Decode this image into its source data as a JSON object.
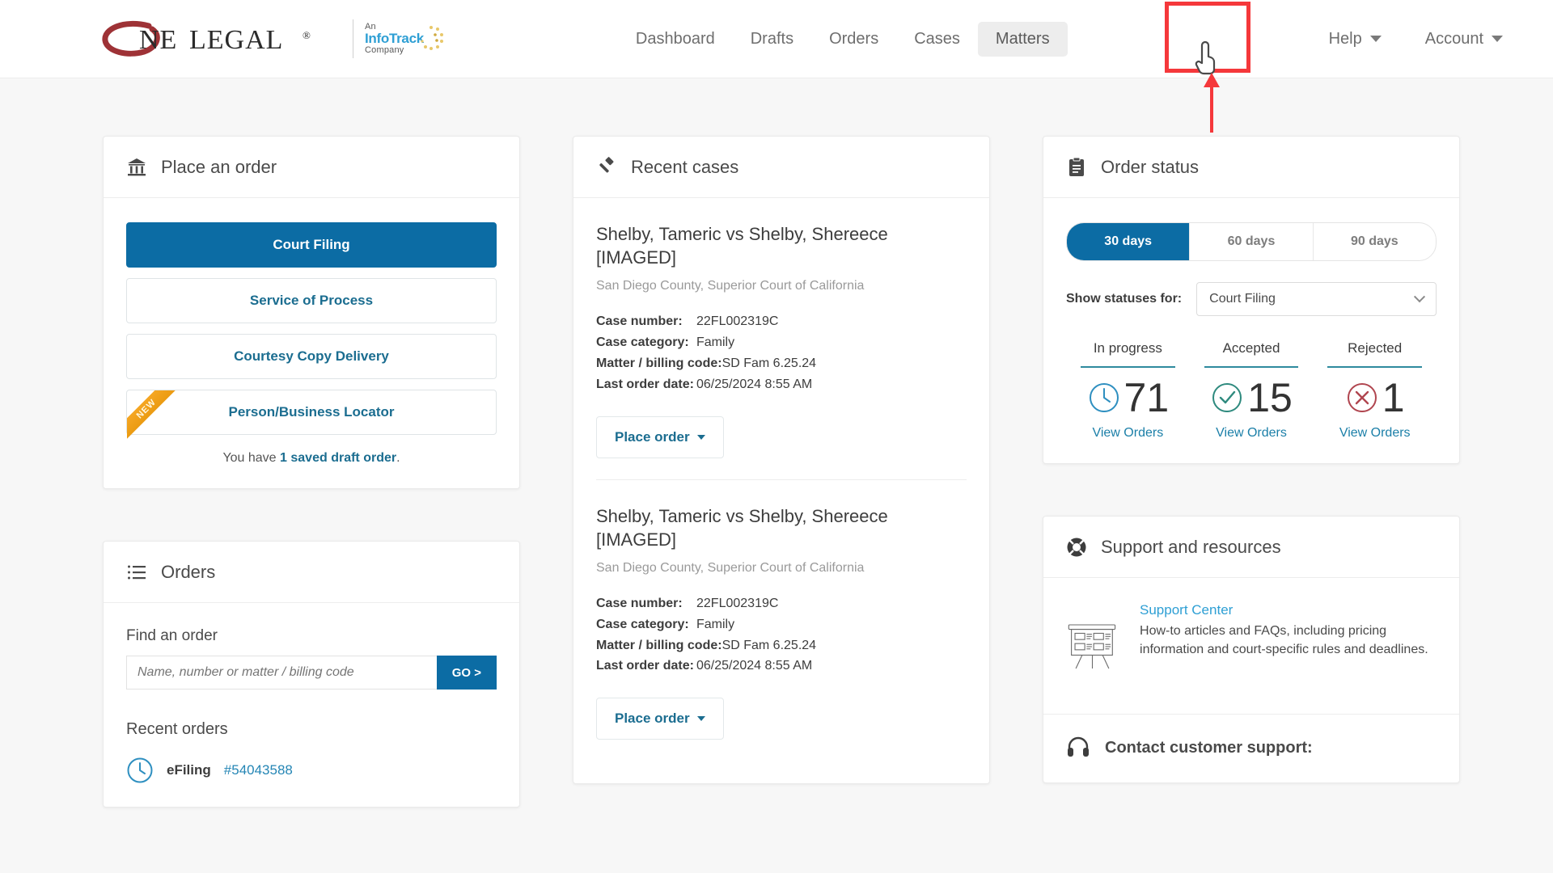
{
  "header": {
    "logo": {
      "word_one": "NE",
      "word_legal": "LEGAL",
      "registered": "®"
    },
    "infotrack": {
      "an": "An",
      "name": "InfoTrack",
      "company": "Company"
    },
    "nav": [
      {
        "label": "Dashboard",
        "active": false,
        "dropdown": false
      },
      {
        "label": "Drafts",
        "active": false,
        "dropdown": false
      },
      {
        "label": "Orders",
        "active": false,
        "dropdown": false
      },
      {
        "label": "Cases",
        "active": false,
        "dropdown": false
      },
      {
        "label": "Matters",
        "active": true,
        "dropdown": false
      }
    ],
    "nav_right": [
      {
        "label": "Help",
        "dropdown": true
      },
      {
        "label": "Account",
        "dropdown": true
      }
    ],
    "annotation": {
      "target": "Matters",
      "box_color": "#f5383b",
      "arrow_color": "#f5383b",
      "cursor": "pointer-hand-cursor"
    }
  },
  "place_order": {
    "title": "Place an order",
    "icon": "courthouse-icon",
    "buttons": [
      {
        "label": "Court Filing",
        "style": "primary",
        "badge": null
      },
      {
        "label": "Service of Process",
        "style": "outline",
        "badge": null
      },
      {
        "label": "Courtesy Copy Delivery",
        "style": "outline",
        "badge": null
      },
      {
        "label": "Person/Business Locator",
        "style": "outline",
        "badge": "NEW"
      }
    ],
    "draft_note_pre": "You have ",
    "draft_note_bold": "1 saved draft order",
    "draft_note_post": "."
  },
  "orders": {
    "title": "Orders",
    "icon": "list-icon",
    "find_label": "Find an order",
    "search_placeholder": "Name, number or matter / billing code",
    "search_value": "",
    "go_label": "GO >",
    "recent_label": "Recent orders",
    "recent": [
      {
        "icon": "clock-icon",
        "type": "eFiling",
        "number": "#54043588"
      }
    ]
  },
  "recent_cases": {
    "title": "Recent cases",
    "icon": "gavel-icon",
    "cases": [
      {
        "title": "Shelby, Tameric vs Shelby, Shereece [IMAGED]",
        "court": "San Diego County, Superior Court of California",
        "case_number_label": "Case number:",
        "case_number": "22FL002319C",
        "case_category_label": "Case category:",
        "case_category": "Family",
        "matter_label": "Matter / billing code:",
        "matter": "SD Fam 6.25.24",
        "last_order_label": "Last order date:",
        "last_order": "06/25/2024 8:55 AM",
        "action_label": "Place order"
      },
      {
        "title": "Shelby, Tameric vs Shelby, Shereece [IMAGED]",
        "court": "San Diego County, Superior Court of California",
        "case_number_label": "Case number:",
        "case_number": "22FL002319C",
        "case_category_label": "Case category:",
        "case_category": "Family",
        "matter_label": "Matter / billing code:",
        "matter": "SD Fam 6.25.24",
        "last_order_label": "Last order date:",
        "last_order": "06/25/2024 8:55 AM",
        "action_label": "Place order"
      }
    ]
  },
  "order_status": {
    "title": "Order status",
    "icon": "clipboard-icon",
    "ranges": [
      {
        "label": "30 days",
        "selected": true
      },
      {
        "label": "60 days",
        "selected": false
      },
      {
        "label": "90 days",
        "selected": false
      }
    ],
    "filter_label": "Show statuses for:",
    "filter_value": "Court Filing",
    "stats": [
      {
        "label": "In progress",
        "value": "71",
        "link": "View Orders",
        "icon": "clock-icon",
        "color": "#2e8fc0"
      },
      {
        "label": "Accepted",
        "value": "15",
        "link": "View Orders",
        "icon": "check-circle-icon",
        "color": "#2e8a7e"
      },
      {
        "label": "Rejected",
        "value": "1",
        "link": "View Orders",
        "icon": "x-circle-icon",
        "color": "#b0454f"
      }
    ]
  },
  "support": {
    "title": "Support and resources",
    "icon": "lifebuoy-icon",
    "center_link": "Support Center",
    "center_icon": "whiteboard-icon",
    "center_desc": "How-to articles and FAQs, including pricing information and court-specific rules and deadlines.",
    "contact_icon": "headset-icon",
    "contact_label": "Contact customer support:"
  },
  "theme": {
    "accent_blue": "#0c6ca4",
    "link_blue": "#1b7fa8",
    "page_bg": "#f7f7f7",
    "annotation_red": "#f5383b",
    "ribbon_orange": "#f5a623"
  }
}
